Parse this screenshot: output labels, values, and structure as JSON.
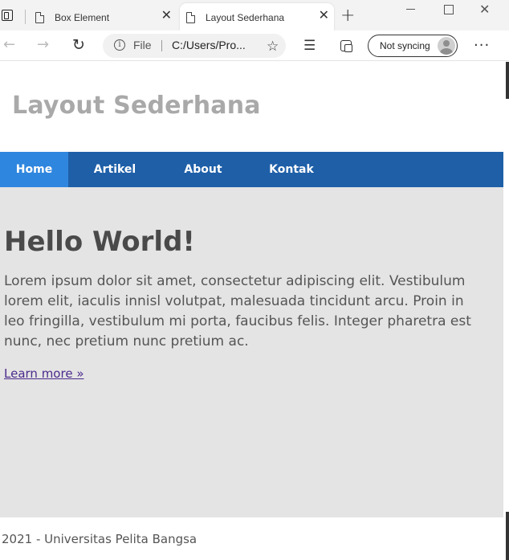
{
  "browser": {
    "tabs": [
      {
        "title": "Box Element"
      },
      {
        "title": "Layout Sederhana"
      }
    ],
    "address": {
      "scheme_label": "File",
      "url": "C:/Users/Pro..."
    },
    "sync_label": "Not syncing",
    "icons": {
      "back": "back-arrow-icon",
      "forward": "forward-arrow-icon",
      "refresh": "refresh-icon",
      "favorite": "add-favorite-icon",
      "favorites": "favorites-list-icon",
      "collections": "collections-icon",
      "more": "more-icon"
    }
  },
  "page": {
    "site_title": "Layout Sederhana",
    "nav": [
      {
        "label": "Home",
        "active": true
      },
      {
        "label": "Artikel",
        "active": false
      },
      {
        "label": "About",
        "active": false
      },
      {
        "label": "Kontak",
        "active": false
      }
    ],
    "hero": {
      "heading": "Hello World!",
      "body": "Lorem ipsum dolor sit amet, consectetur adipiscing elit. Vestibulum lorem elit, iaculis innisl volutpat, malesuada tincidunt arcu. Proin in leo fringilla, vestibulum mi porta, faucibus felis. Integer pharetra est nunc, nec pretium nunc pretium ac.",
      "link": "Learn more »"
    },
    "footer": "2021 - Universitas Pelita Bangsa"
  },
  "colors": {
    "nav_bg": "#1e5fa8",
    "nav_active": "#2f86de",
    "hero_bg": "#e4e4e4",
    "title": "#a9a9a9"
  }
}
